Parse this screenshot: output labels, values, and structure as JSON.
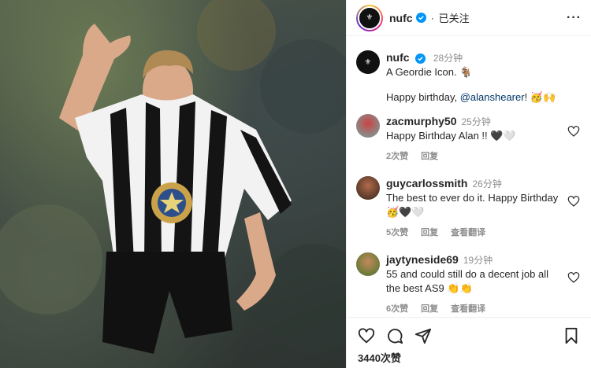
{
  "post": {
    "username": "nufc",
    "follow_status": "已关注",
    "more_icon": "more-icon"
  },
  "caption": {
    "username": "nufc",
    "time": "28分钟",
    "line1": "A Geordie Icon. 🐐",
    "line2_prefix": "Happy birthday, ",
    "mention": "@alanshearer",
    "line2_suffix": "! 🥳🙌"
  },
  "comments": [
    {
      "username": "zacmurphy50",
      "time": "25分钟",
      "text": "Happy Birthday Alan !! 🖤🤍",
      "likes": "2次赞",
      "reply": "回复",
      "translate": ""
    },
    {
      "username": "guycarlossmith",
      "time": "26分钟",
      "text": "The best to ever do it. Happy Birthday 🥳🖤🤍",
      "likes": "5次赞",
      "reply": "回复",
      "translate": "查看翻译"
    },
    {
      "username": "jaytyneside69",
      "time": "19分钟",
      "text": "55 and could still do a decent job all the best AS9 👏👏",
      "likes": "6次赞",
      "reply": "回复",
      "translate": "查看翻译"
    }
  ],
  "footer": {
    "likes_count": "3440次赞"
  },
  "colors": {
    "verified": "#0095f6",
    "mention": "#00376b",
    "muted": "#8e8e8e"
  }
}
